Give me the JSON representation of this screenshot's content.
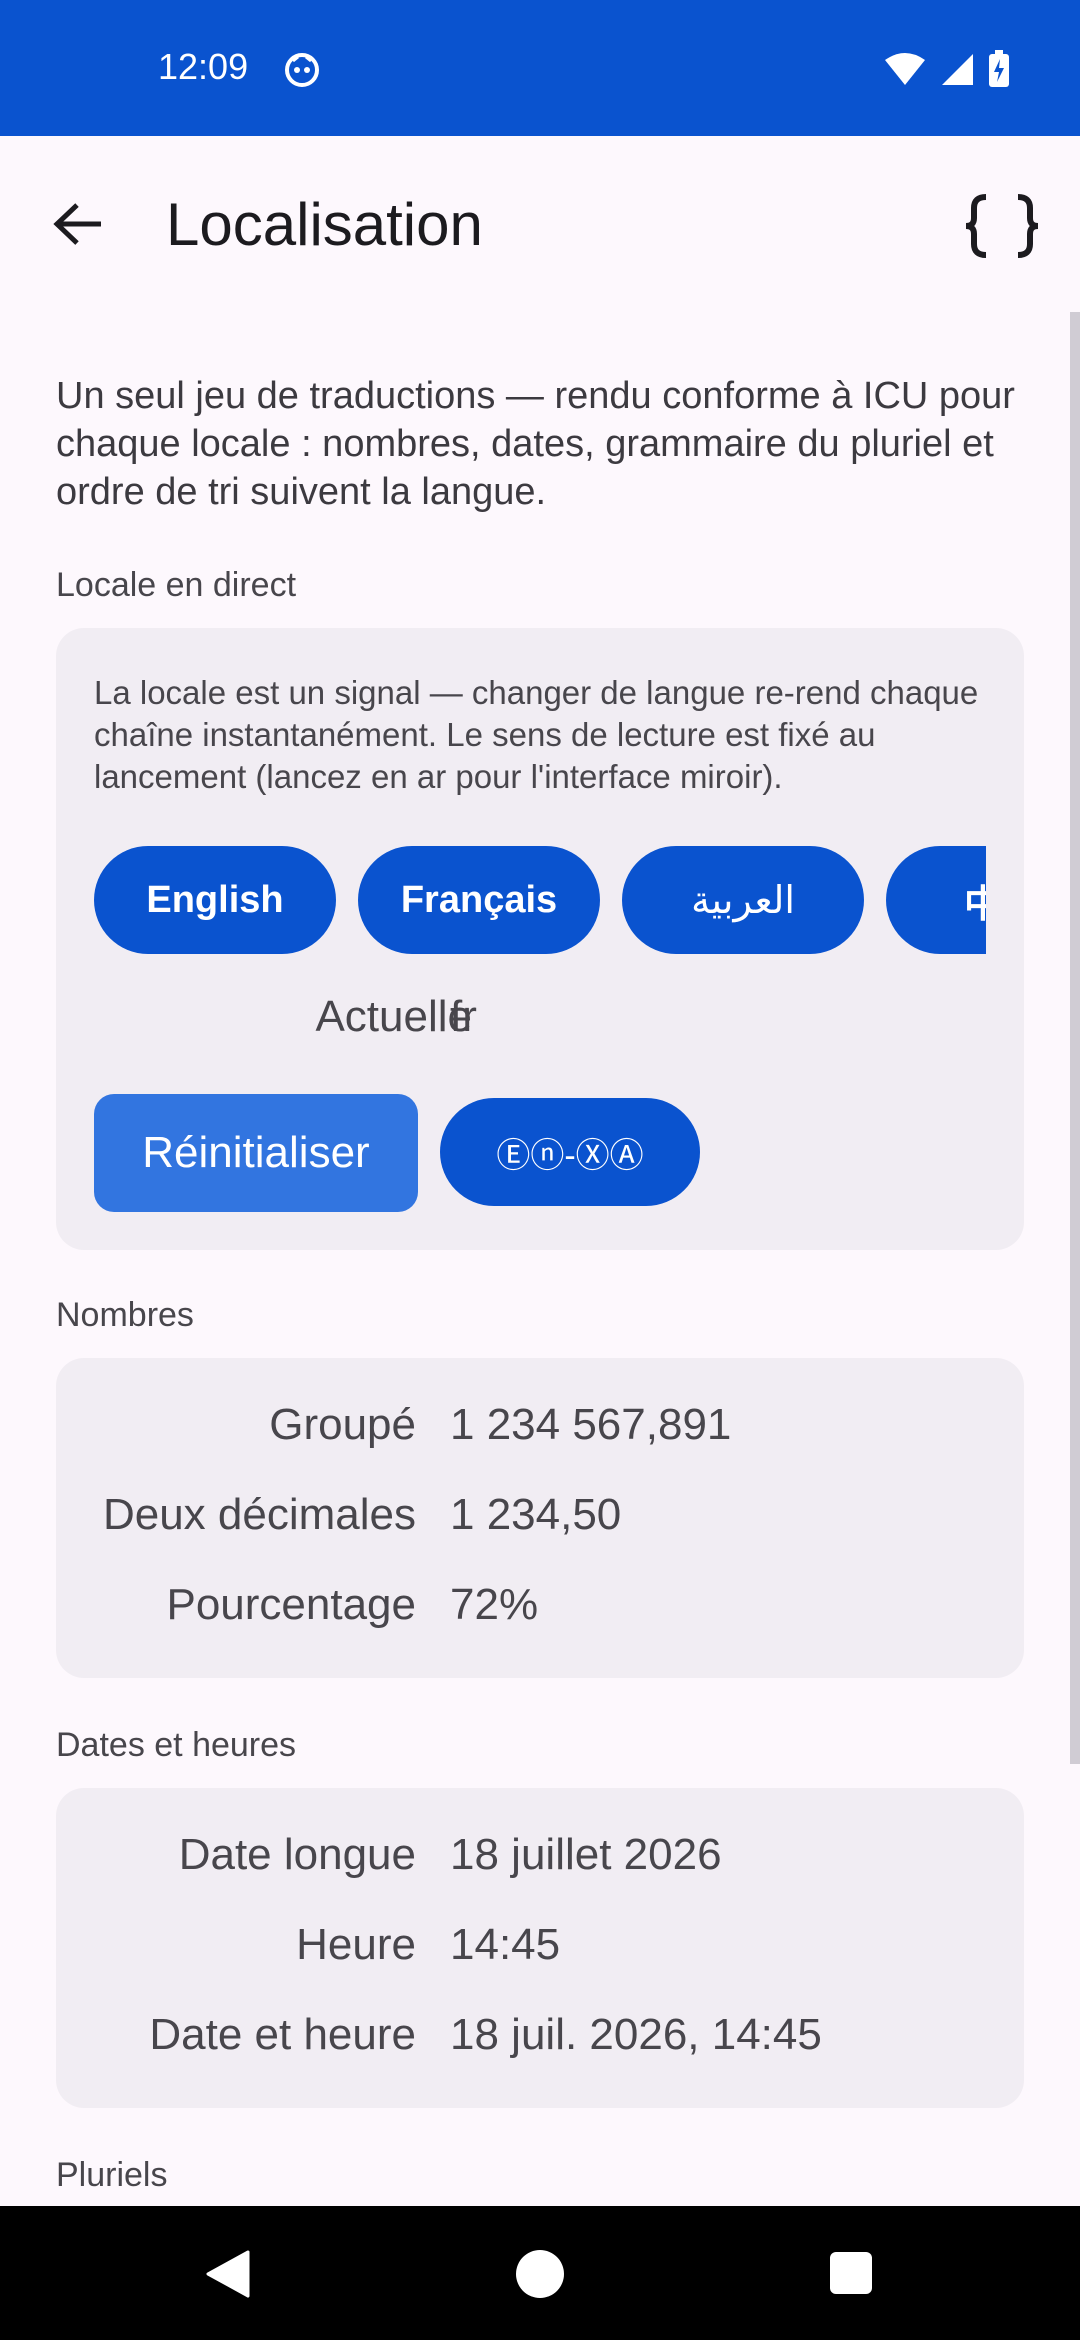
{
  "status": {
    "time": "12:09"
  },
  "appbar": {
    "title": "Localisation",
    "back_icon": "arrow-left-icon",
    "action_icon": "code-braces-icon"
  },
  "intro": "Un seul jeu de traductions — rendu conforme à ICU pour chaque locale : nombres, dates, grammaire du pluriel et ordre de tri suivent la langue.",
  "live_locale": {
    "label": "Locale en direct",
    "note": "La locale est un signal — changer de langue re-rend chaque chaîne instantanément. Le sens de lecture est fixé au lancement (lancez en ar pour l'interface miroir).",
    "languages": [
      "English",
      "Français",
      "العربية",
      "中"
    ],
    "current_key": "Actuelle",
    "current_value": "fr",
    "reset_label": "Réinitialiser",
    "pseudo_label": "Ⓔⓝ-ⓍⒶ"
  },
  "numbers": {
    "label": "Nombres",
    "rows": [
      {
        "key": "Groupé",
        "value": "1 234 567,891"
      },
      {
        "key": "Deux décimales",
        "value": "1 234,50"
      },
      {
        "key": "Pourcentage",
        "value": "72%"
      }
    ]
  },
  "dates": {
    "label": "Dates et heures",
    "rows": [
      {
        "key": "Date longue",
        "value": "18 juillet 2026"
      },
      {
        "key": "Heure",
        "value": "14:45"
      },
      {
        "key": "Date et heure",
        "value": "18 juil. 2026, 14:45"
      }
    ]
  },
  "plurals": {
    "label": "Pluriels"
  },
  "colors": {
    "primary": "#0a53cf",
    "reset_button": "#3275e0",
    "card": "#f1edf3",
    "background": "#fdf8fd"
  }
}
